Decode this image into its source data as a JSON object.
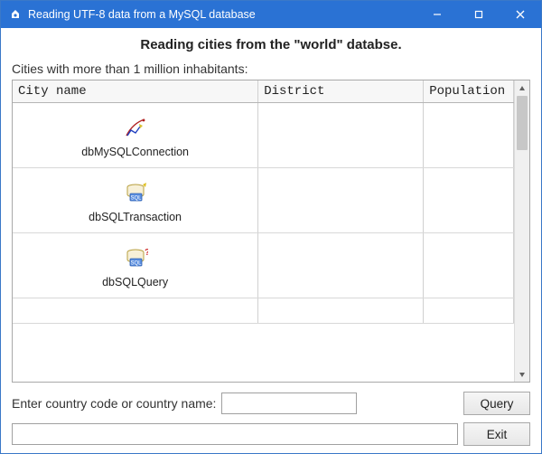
{
  "window": {
    "title": "Reading UTF-8 data from a MySQL database"
  },
  "heading": "Reading cities from the \"world\" databse.",
  "subheading": "Cities with more than 1 million inhabitants:",
  "columns": {
    "c0": "City name",
    "c1": "District",
    "c2": "Population"
  },
  "designer_items": {
    "i0": "dbMySQLConnection",
    "i1": "dbSQLTransaction",
    "i2": "dbSQLQuery"
  },
  "form": {
    "country_label": "Enter country code or country name:",
    "country_value": "",
    "status_value": ""
  },
  "buttons": {
    "query": "Query",
    "exit": "Exit"
  }
}
